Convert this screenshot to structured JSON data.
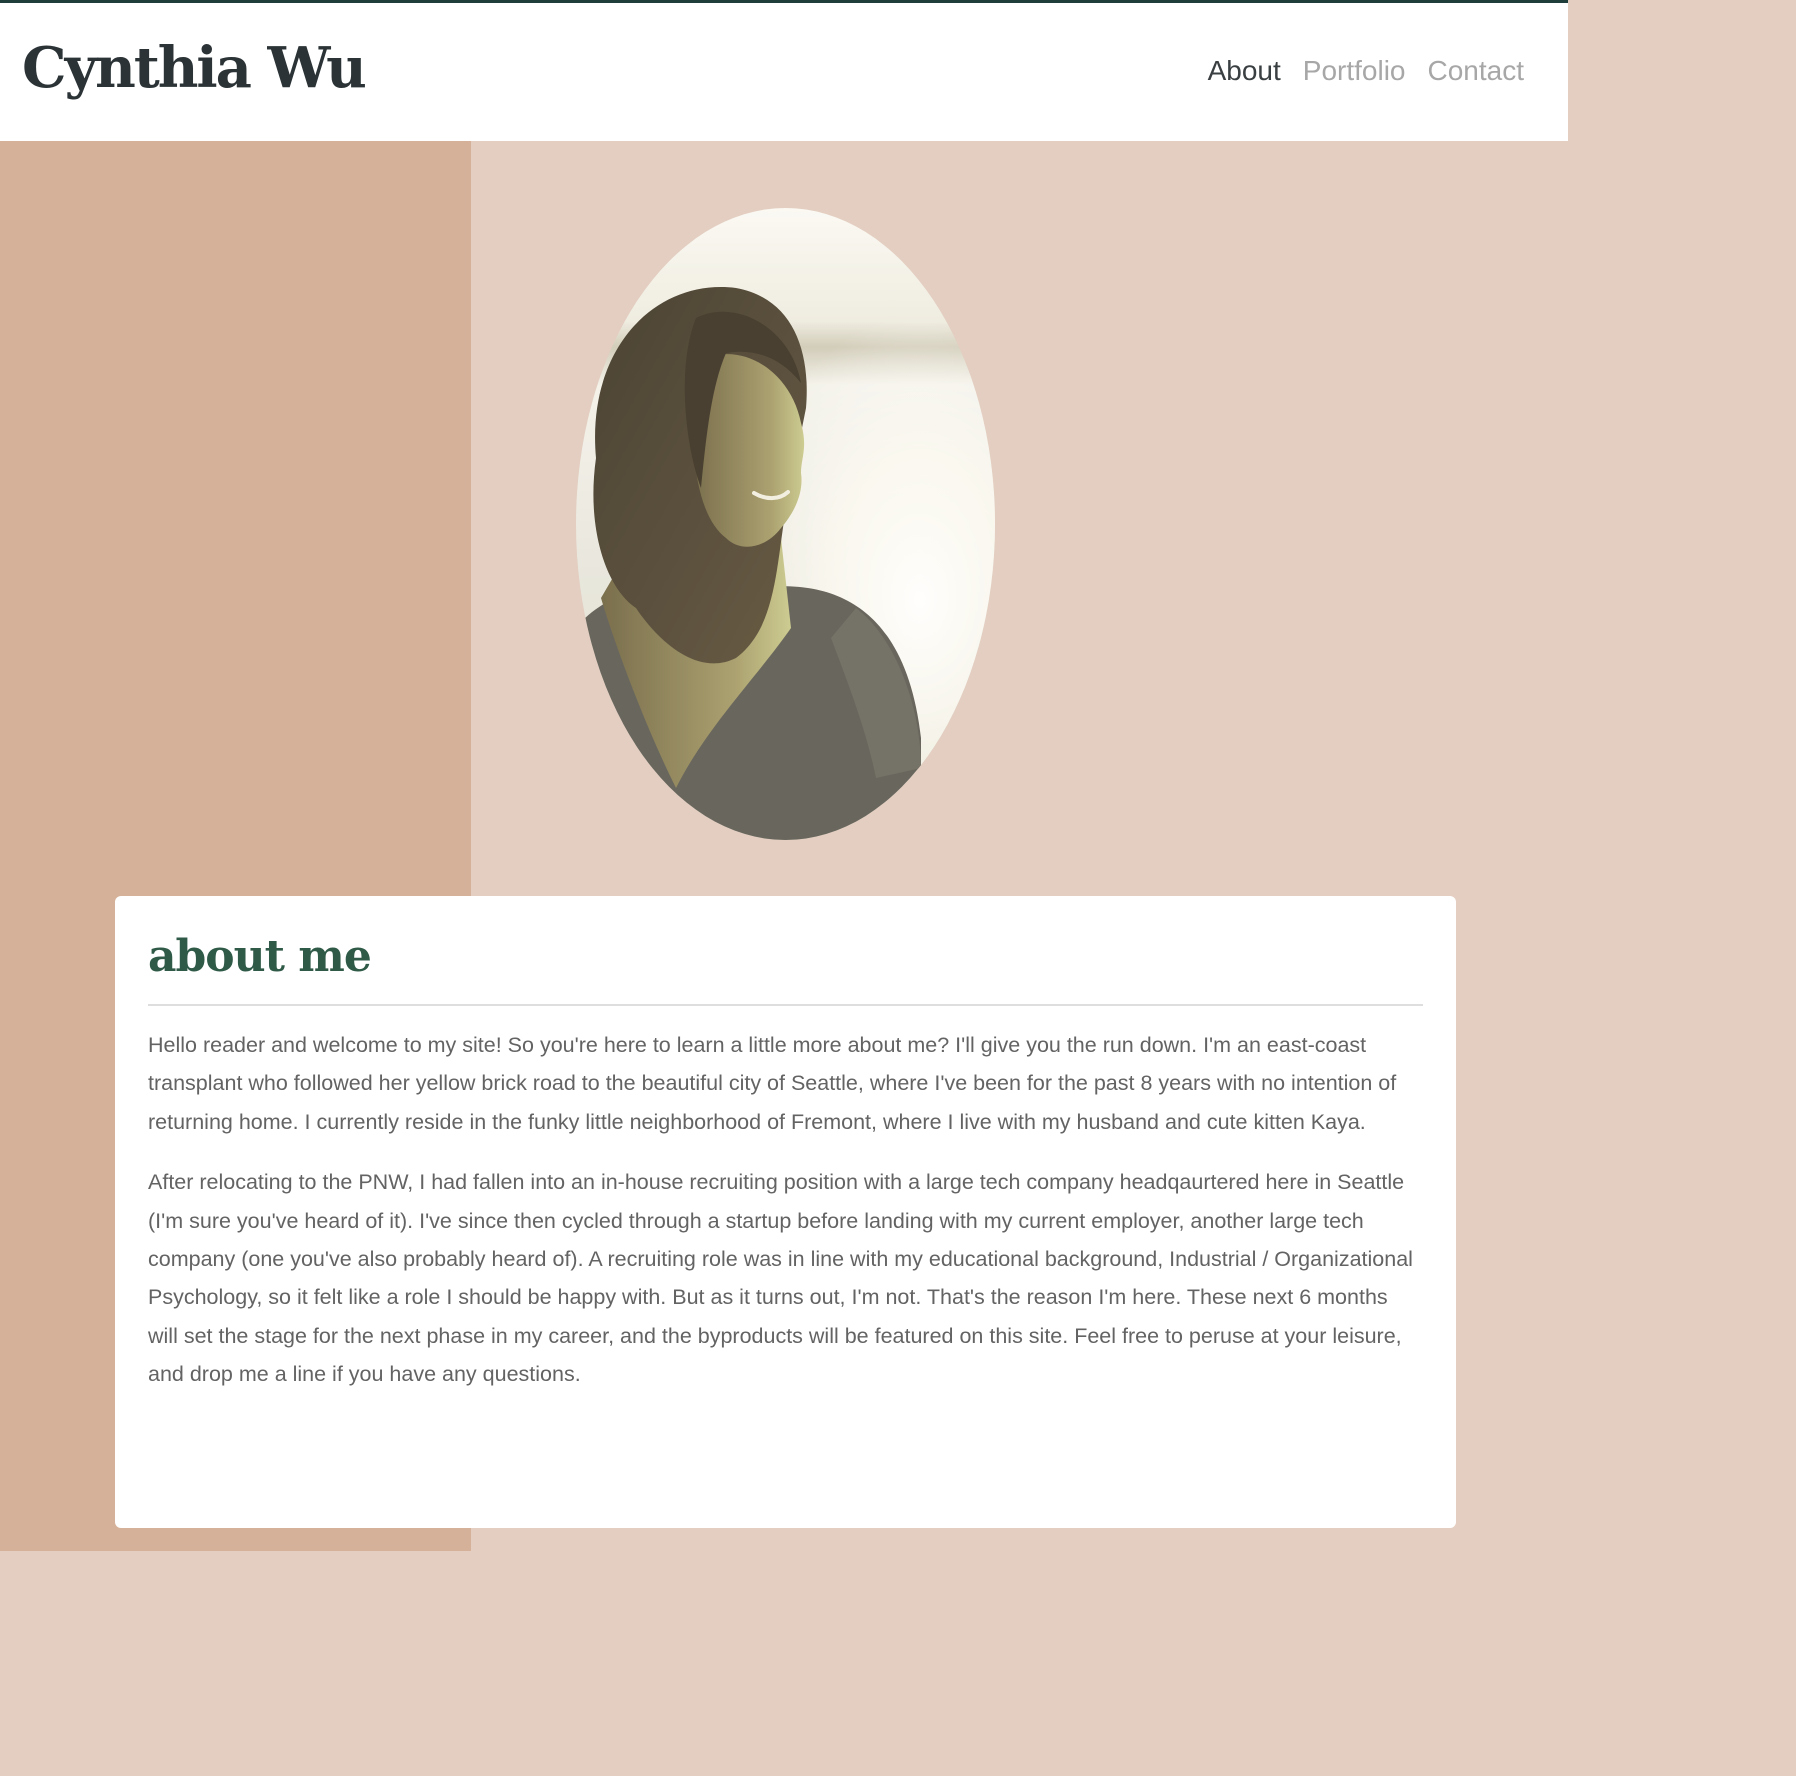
{
  "header": {
    "brand": "Cynthia Wu",
    "nav": [
      {
        "label": "About",
        "active": true
      },
      {
        "label": "Portfolio",
        "active": false
      },
      {
        "label": "Contact",
        "active": false
      }
    ]
  },
  "hero": {
    "photo": "portrait-photo"
  },
  "about": {
    "heading": "about me",
    "paragraphs": [
      "Hello reader and welcome to my site! So you're here to learn a little more about me? I'll give you the run down. I'm an east-coast transplant who followed her yellow brick road to the beautiful city of Seattle, where I've been for the past 8 years with no intention of returning home. I currently reside in the funky little neighborhood of Fremont, where I live with my husband and cute kitten Kaya.",
      "After relocating to the PNW, I had fallen into an in-house recruiting position with a large tech company headqaurtered here in Seattle (I'm sure you've heard of it). I've since then cycled through a startup before landing with my current employer, another large tech company (one you've also probably heard of). A recruiting role was in line with my educational background, Industrial / Organizational Psychology, so it felt like a role I should be happy with. But as it turns out, I'm not. That's the reason I'm here. These next 6 months will set the stage for the next phase in my career, and the byproducts will be featured on this site. Feel free to peruse at your leisure, and drop me a line if you have any questions."
    ]
  },
  "colors": {
    "top_line": "#1f3d3a",
    "brand_text": "#2b3336",
    "nav_active": "#3a3f42",
    "nav_inactive": "#a7a7a7",
    "left_band": "#d6b199",
    "background": "#e3cec1",
    "heading": "#2f5a48",
    "body_text": "#636363"
  }
}
